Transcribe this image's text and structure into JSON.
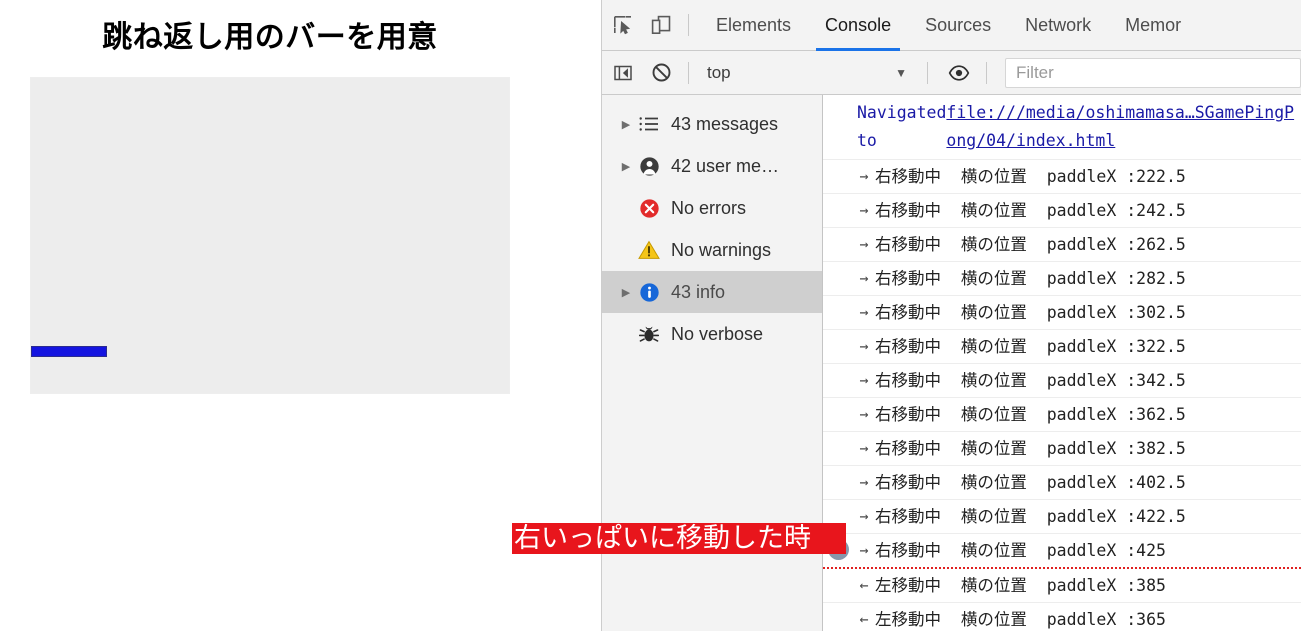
{
  "page": {
    "title": "跳ね返し用のバーを用意",
    "paddle_color": "#1414e0",
    "game_bg": "#ededed"
  },
  "annotation": {
    "text": "右いっぱいに移動した時",
    "bg_color": "#e8151c",
    "text_color": "#ffffff"
  },
  "devtools": {
    "toolbar": {
      "inspect_icon": "inspect-element-icon",
      "device_icon": "device-toolbar-icon"
    },
    "tabs": [
      {
        "label": "Elements",
        "active": false
      },
      {
        "label": "Console",
        "active": true
      },
      {
        "label": "Sources",
        "active": false
      },
      {
        "label": "Network",
        "active": false
      },
      {
        "label": "Memor",
        "active": false
      }
    ],
    "active_tab_underline_color": "#1a73e8",
    "filterbar": {
      "sidebar_toggle_icon": "show-console-sidebar-icon",
      "clear_icon": "clear-console-icon",
      "context_value": "top",
      "caret": "▼",
      "eye_icon": "live-expression-icon",
      "filter_placeholder": "Filter",
      "filter_value": ""
    },
    "sidebar": [
      {
        "label": "43 messages",
        "icon": "list-icon",
        "expandable": true,
        "selected": false
      },
      {
        "label": "42 user me…",
        "icon": "user-icon",
        "expandable": true,
        "selected": false
      },
      {
        "label": "No errors",
        "icon": "error-icon",
        "expandable": false,
        "selected": false
      },
      {
        "label": "No warnings",
        "icon": "warning-icon",
        "expandable": false,
        "selected": false
      },
      {
        "label": "43 info",
        "icon": "info-icon",
        "expandable": true,
        "selected": true
      },
      {
        "label": "No verbose",
        "icon": "verbose-icon",
        "expandable": false,
        "selected": false
      }
    ],
    "console_rows": [
      {
        "kind": "navigation",
        "prefix": "Navigated to ",
        "link": "file:///media/oshimamasa…SGamePingPong/04/index.html"
      },
      {
        "kind": "log",
        "arrow": "→",
        "text": "右移動中  横の位置  paddleX :222.5"
      },
      {
        "kind": "log",
        "arrow": "→",
        "text": "右移動中  横の位置  paddleX :242.5"
      },
      {
        "kind": "log",
        "arrow": "→",
        "text": "右移動中  横の位置  paddleX :262.5"
      },
      {
        "kind": "log",
        "arrow": "→",
        "text": "右移動中  横の位置  paddleX :282.5"
      },
      {
        "kind": "log",
        "arrow": "→",
        "text": "右移動中  横の位置  paddleX :302.5"
      },
      {
        "kind": "log",
        "arrow": "→",
        "text": "右移動中  横の位置  paddleX :322.5"
      },
      {
        "kind": "log",
        "arrow": "→",
        "text": "右移動中  横の位置  paddleX :342.5"
      },
      {
        "kind": "log",
        "arrow": "→",
        "text": "右移動中  横の位置  paddleX :362.5"
      },
      {
        "kind": "log",
        "arrow": "→",
        "text": "右移動中  横の位置  paddleX :382.5"
      },
      {
        "kind": "log",
        "arrow": "→",
        "text": "右移動中  横の位置  paddleX :402.5"
      },
      {
        "kind": "log",
        "arrow": "→",
        "text": "右移動中  横の位置  paddleX :422.5"
      },
      {
        "kind": "log",
        "arrow": "→",
        "text": "右移動中  横の位置  paddleX :425",
        "badge": "2",
        "annotated": true
      },
      {
        "kind": "log",
        "arrow": "←",
        "text": "左移動中  横の位置  paddleX :385"
      },
      {
        "kind": "log",
        "arrow": "←",
        "text": "左移動中  横の位置  paddleX :365"
      }
    ]
  }
}
